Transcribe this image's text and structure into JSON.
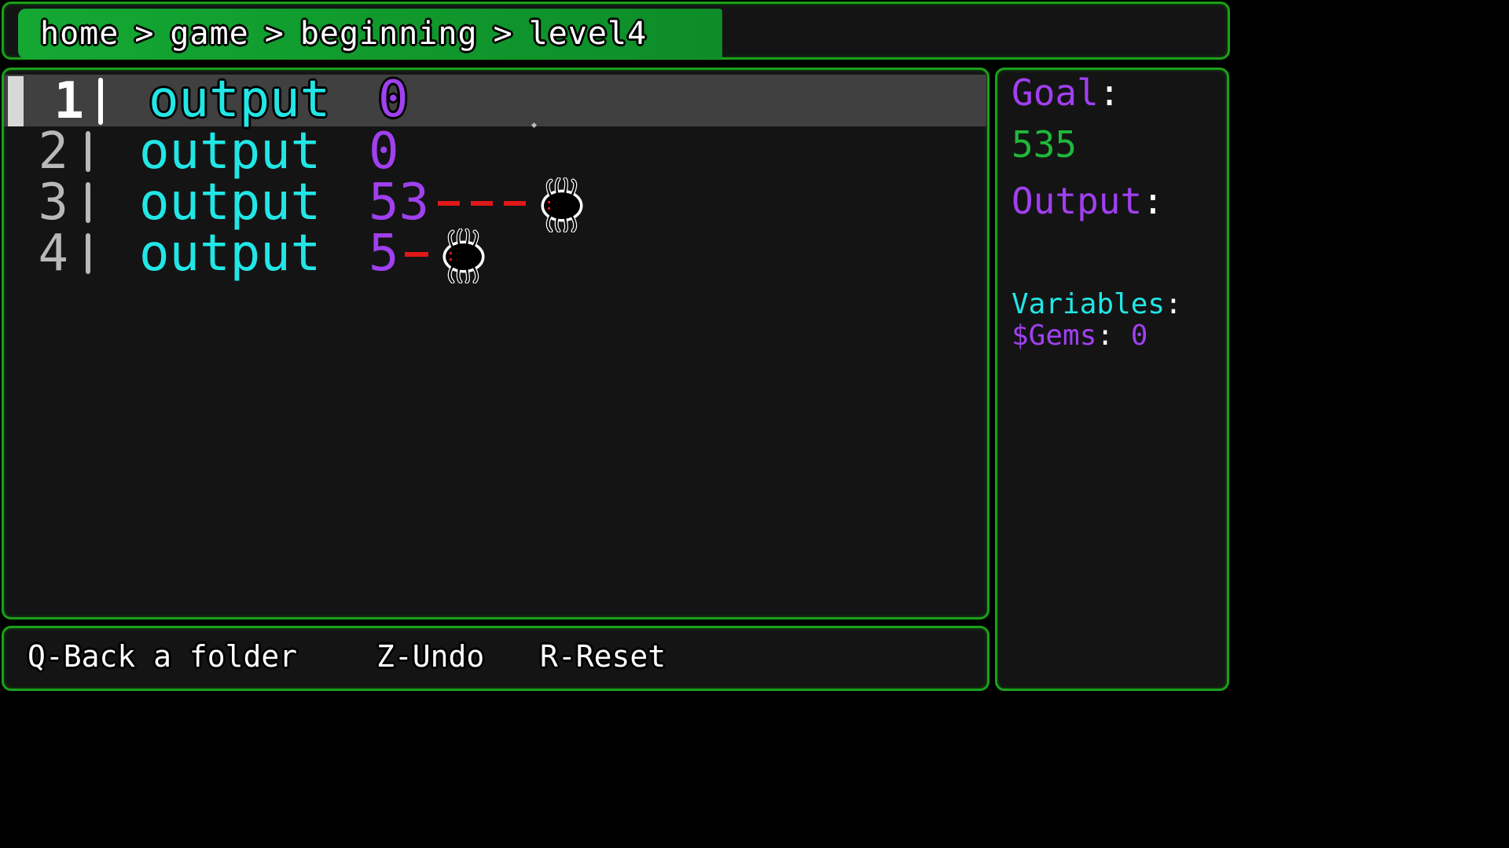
{
  "breadcrumb": {
    "items": [
      "home",
      "game",
      "beginning",
      "level4"
    ],
    "separator": ">"
  },
  "editor": {
    "lines": [
      {
        "number": "1",
        "keyword": "output",
        "value": "0",
        "active": true
      },
      {
        "number": "2",
        "keyword": "output",
        "value": "0",
        "active": false
      },
      {
        "number": "3",
        "keyword": "output",
        "value": "53",
        "active": false
      },
      {
        "number": "4",
        "keyword": "output",
        "value": "5",
        "active": false
      }
    ]
  },
  "side": {
    "goal_label": "Goal",
    "goal_value": "535",
    "output_label": "Output",
    "output_value": "",
    "variables_label": "Variables",
    "variables": [
      {
        "name": "$Gems",
        "value": "0"
      }
    ]
  },
  "hints": {
    "back": "Q-Back a folder",
    "undo": "Z-Undo",
    "reset": "R-Reset"
  },
  "icons": {
    "bug": "spider-bug-icon"
  },
  "colors": {
    "keyword": "#22e6e6",
    "number": "#a040f0",
    "goal": "#1fb83a",
    "border": "#1aa01a",
    "bug_trail": "#e01818"
  }
}
